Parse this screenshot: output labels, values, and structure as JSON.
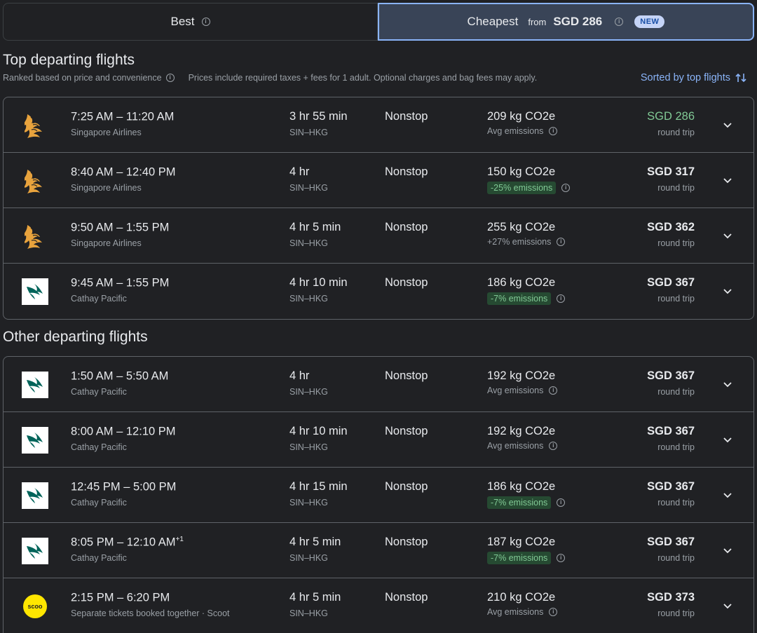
{
  "tabs": {
    "best_label": "Best",
    "cheapest_label": "Cheapest",
    "cheapest_from": "from",
    "cheapest_price": "SGD 286",
    "new_badge": "NEW"
  },
  "top_section": {
    "title": "Top departing flights",
    "ranked_note": "Ranked based on price and convenience",
    "prices_note": "Prices include required taxes + fees for 1 adult. Optional charges and bag fees may apply.",
    "sort_label": "Sorted by top flights"
  },
  "other_section": {
    "title": "Other departing flights"
  },
  "colors": {
    "accent": "#8ab4f8",
    "price_green": "#81c995",
    "emission_pill_bg": "#264a32"
  },
  "top_flights": [
    {
      "logo": "singapore-airlines-logo",
      "times": "7:25 AM – 11:20 AM",
      "plus": "",
      "airline": "Singapore Airlines",
      "duration": "3 hr 55 min",
      "route": "SIN–HKG",
      "stops": "Nonstop",
      "co2": "209 kg CO2e",
      "emissions": "Avg emissions",
      "pill": false,
      "price": "SGD 286",
      "price_green": true,
      "trip": "round trip"
    },
    {
      "logo": "singapore-airlines-logo",
      "times": "8:40 AM – 12:40 PM",
      "plus": "",
      "airline": "Singapore Airlines",
      "duration": "4 hr",
      "route": "SIN–HKG",
      "stops": "Nonstop",
      "co2": "150 kg CO2e",
      "emissions": "-25% emissions",
      "pill": true,
      "price": "SGD 317",
      "price_green": false,
      "trip": "round trip"
    },
    {
      "logo": "singapore-airlines-logo",
      "times": "9:50 AM – 1:55 PM",
      "plus": "",
      "airline": "Singapore Airlines",
      "duration": "4 hr 5 min",
      "route": "SIN–HKG",
      "stops": "Nonstop",
      "co2": "255 kg CO2e",
      "emissions": "+27% emissions",
      "pill": false,
      "price": "SGD 362",
      "price_green": false,
      "trip": "round trip"
    },
    {
      "logo": "cathay-pacific-logo",
      "times": "9:45 AM – 1:55 PM",
      "plus": "",
      "airline": "Cathay Pacific",
      "duration": "4 hr 10 min",
      "route": "SIN–HKG",
      "stops": "Nonstop",
      "co2": "186 kg CO2e",
      "emissions": "-7% emissions",
      "pill": true,
      "price": "SGD 367",
      "price_green": false,
      "trip": "round trip"
    }
  ],
  "other_flights": [
    {
      "logo": "cathay-pacific-logo",
      "times": "1:50 AM – 5:50 AM",
      "plus": "",
      "airline": "Cathay Pacific",
      "duration": "4 hr",
      "route": "SIN–HKG",
      "stops": "Nonstop",
      "co2": "192 kg CO2e",
      "emissions": "Avg emissions",
      "pill": false,
      "price": "SGD 367",
      "price_green": false,
      "trip": "round trip"
    },
    {
      "logo": "cathay-pacific-logo",
      "times": "8:00 AM – 12:10 PM",
      "plus": "",
      "airline": "Cathay Pacific",
      "duration": "4 hr 10 min",
      "route": "SIN–HKG",
      "stops": "Nonstop",
      "co2": "192 kg CO2e",
      "emissions": "Avg emissions",
      "pill": false,
      "price": "SGD 367",
      "price_green": false,
      "trip": "round trip"
    },
    {
      "logo": "cathay-pacific-logo",
      "times": "12:45 PM – 5:00 PM",
      "plus": "",
      "airline": "Cathay Pacific",
      "duration": "4 hr 15 min",
      "route": "SIN–HKG",
      "stops": "Nonstop",
      "co2": "186 kg CO2e",
      "emissions": "-7% emissions",
      "pill": true,
      "price": "SGD 367",
      "price_green": false,
      "trip": "round trip"
    },
    {
      "logo": "cathay-pacific-logo",
      "times": "8:05 PM – 12:10 AM",
      "plus": "+1",
      "airline": "Cathay Pacific",
      "duration": "4 hr 5 min",
      "route": "SIN–HKG",
      "stops": "Nonstop",
      "co2": "187 kg CO2e",
      "emissions": "-7% emissions",
      "pill": true,
      "price": "SGD 367",
      "price_green": false,
      "trip": "round trip"
    },
    {
      "logo": "scoot-logo",
      "logo_text": "scoo",
      "times": "2:15 PM – 6:20 PM",
      "plus": "",
      "airline": "Separate tickets booked together · Scoot",
      "duration": "4 hr 5 min",
      "route": "SIN–HKG",
      "stops": "Nonstop",
      "co2": "210 kg CO2e",
      "emissions": "Avg emissions",
      "pill": false,
      "price": "SGD 373",
      "price_green": false,
      "trip": "round trip"
    }
  ]
}
